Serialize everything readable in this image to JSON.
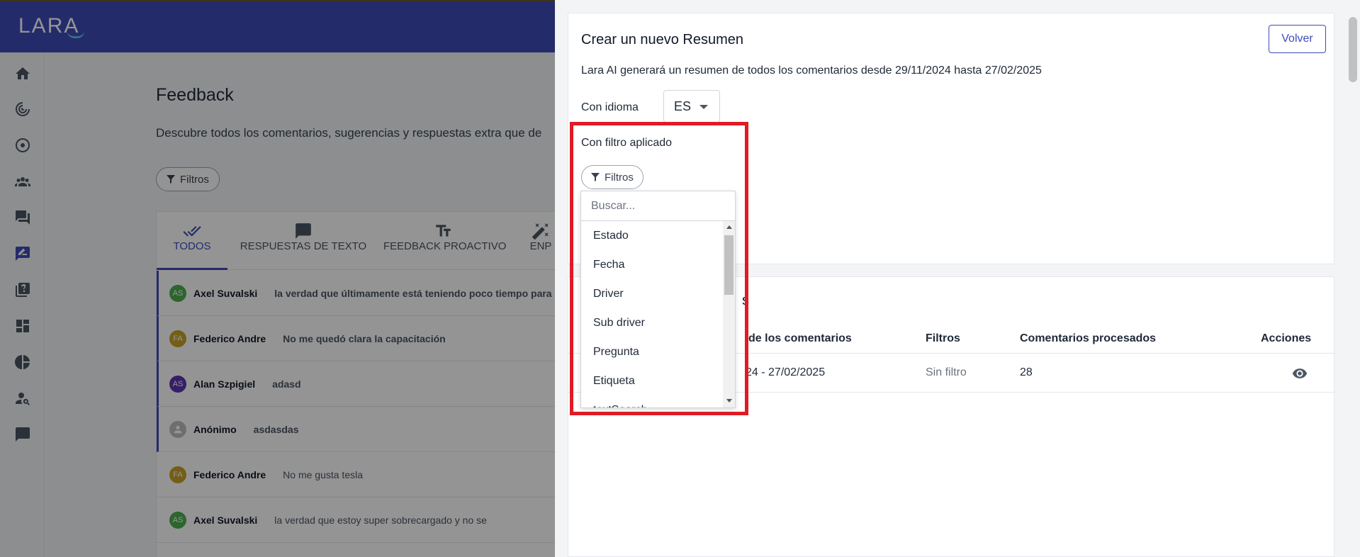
{
  "app": {
    "logo": "LARA"
  },
  "background": {
    "title": "Feedback",
    "description": "Descubre todos los comentarios, sugerencias y respuestas extra que de",
    "filter_label": "Filtros",
    "tabs": [
      {
        "label": "TODOS",
        "icon": "double-check-icon"
      },
      {
        "label": "RESPUESTAS DE TEXTO",
        "icon": "chat-bubble-icon"
      },
      {
        "label": "FEEDBACK PROACTIVO",
        "icon": "text-size-icon"
      },
      {
        "label": "ENP",
        "icon": "sparkle-icon"
      }
    ],
    "rows": [
      {
        "initials": "AS",
        "color": "#4caf50",
        "name": "Axel Suvalski",
        "text": "la verdad que últimamente está teniendo poco tiempo para mi",
        "bold_text": true,
        "marked": true
      },
      {
        "initials": "FA",
        "color": "#c9a227",
        "name": "Federico Andre",
        "text": "No me quedó clara la capacitación",
        "bold_text": true,
        "marked": true
      },
      {
        "initials": "AS",
        "color": "#5e35b1",
        "name": "Alan Szpigiel",
        "text": "adasd",
        "bold_text": true,
        "marked": true
      },
      {
        "initials": "",
        "color": "#bdbdbd",
        "name": "Anónimo",
        "text": "asdasdas",
        "bold_text": true,
        "marked": true
      },
      {
        "initials": "FA",
        "color": "#c9a227",
        "name": "Federico Andre",
        "text": "No me gusta tesla",
        "bold_text": false,
        "marked": false
      },
      {
        "initials": "AS",
        "color": "#4caf50",
        "name": "Axel Suvalski",
        "text": "la verdad que estoy super sobrecargado y no se",
        "bold_text": false,
        "marked": false
      }
    ]
  },
  "drawer": {
    "title": "Crear un nuevo Resumen",
    "back_label": "Volver",
    "description": "Lara AI generará un resumen de todos los comentarios desde 29/11/2024 hasta 27/02/2025",
    "language_label": "Con idioma",
    "language_value": "ES",
    "filter_section_label": "Con filtro aplicado",
    "filter_button_label": "Filtros",
    "dropdown": {
      "search_placeholder": "Buscar...",
      "options": [
        "Estado",
        "Fecha",
        "Driver",
        "Sub driver",
        "Pregunta",
        "Etiqueta",
        "textSearch"
      ]
    },
    "summaries": {
      "title_fragment": "s",
      "columns": {
        "range": "de los comentarios",
        "filters": "Filtros",
        "processed": "Comentarios procesados",
        "actions": "Acciones"
      },
      "rows": [
        {
          "range": "24 - 27/02/2025",
          "filters": "Sin filtro",
          "processed": "28"
        }
      ]
    }
  },
  "colors": {
    "brand": "#3f4bb8",
    "highlight": "#e01b24"
  }
}
